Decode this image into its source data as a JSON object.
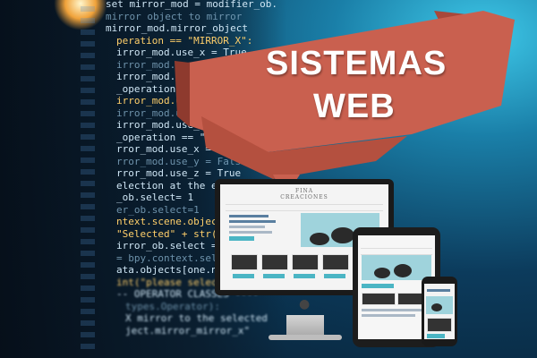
{
  "banner": {
    "line1": "SISTEMAS",
    "line2": "WEB",
    "ribbon_color": "#c9604f",
    "ribbon_shadow": "#9d3e31"
  },
  "code_lines": [
    "set mirror_mod = modifier_ob.",
    "mirror object to mirror",
    "mirror_mod.mirror_object",
    "peration == \"MIRROR_X\":",
    "irror_mod.use_x = True",
    "irror_mod.use_y = False",
    "irror_mod.use_z = False",
    "_operation == \"MIRROR_Y\"",
    "irror_mod.use_x = False",
    "irror_mod.use_y = True",
    "irror_mod.use_z = False",
    "_operation == \"MIRROR_Z\"",
    "rror_mod.use_x = False",
    "rror_mod.use_y = False",
    "rror_mod.use_z = True",
    "election at the end -add",
    "_ob.select= 1",
    "er_ob.select=1",
    "ntext.scene.objects.activ",
    "\"Selected\" + str(modifie",
    "irror_ob.select = 0",
    "= bpy.context.selected_obj",
    "ata.objects[one.name].sel",
    "int(\"please select exactl",
    "-- OPERATOR CLASSES ----",
    "types.Operator):",
    "X mirror to the selected",
    "ject.mirror_mirror_x\""
  ],
  "devices": {
    "monitor_icon": "apple-logo-icon",
    "site_brand": "FINA\nCREACIONES"
  }
}
